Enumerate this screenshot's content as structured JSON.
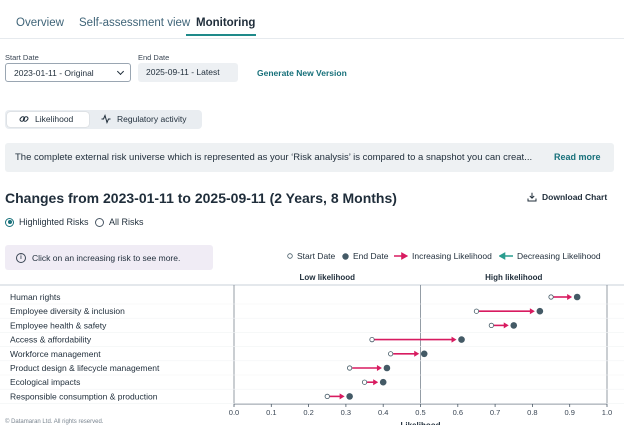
{
  "tabs": [
    "Overview",
    "Self-assessment view",
    "Monitoring"
  ],
  "filters": {
    "start_label": "Start Date",
    "start_value": "2023-01-11 - Original",
    "end_label": "End Date",
    "end_value": "2025-09-11 - Latest",
    "generate_label": "Generate New Version"
  },
  "toggle": {
    "likelihood": "Likelihood",
    "regulatory": "Regulatory activity"
  },
  "banner": {
    "text": "The complete external risk universe which is represented as your ‘Risk analysis’ is compared to a snapshot you can creat...",
    "link": "Read more"
  },
  "heading": "Changes from 2023-01-11 to 2025-09-11 (2 Years, 8 Months)",
  "download_label": "Download Chart",
  "radios": {
    "highlighted": "Highlighted Risks",
    "all": "All Risks"
  },
  "info_text": "Click on an increasing risk to see more.",
  "legend": {
    "start": "Start Date",
    "end": "End Date",
    "increasing": "Increasing Likelihood",
    "decreasing": "Decreasing Likelihood"
  },
  "footer": "© Datamaran Ltd. All rights reserved.",
  "colors": {
    "accent": "#17707a",
    "increase": "#d81b60",
    "decrease": "#2a9d8f",
    "end_dot": "#445a66"
  },
  "chart_data": {
    "type": "dumbbell",
    "section_labels": [
      "Low likelihood",
      "High likelihood"
    ],
    "xlabel": "Likelihood",
    "xlim": [
      0.0,
      1.0
    ],
    "x_ticks": [
      "0.0",
      "0.1",
      "0.2",
      "0.3",
      "0.4",
      "0.5",
      "0.6",
      "0.7",
      "0.8",
      "0.9",
      "1.0"
    ],
    "grid": false,
    "categories": [
      "Human rights",
      "Employee diversity & inclusion",
      "Employee health & safety",
      "Access & affordability",
      "Workforce management",
      "Product design & lifecycle management",
      "Ecological impacts",
      "Responsible consumption & production"
    ],
    "start": [
      0.85,
      0.65,
      0.69,
      0.37,
      0.42,
      0.31,
      0.35,
      0.25
    ],
    "end": [
      0.92,
      0.82,
      0.75,
      0.61,
      0.51,
      0.41,
      0.4,
      0.31
    ]
  }
}
